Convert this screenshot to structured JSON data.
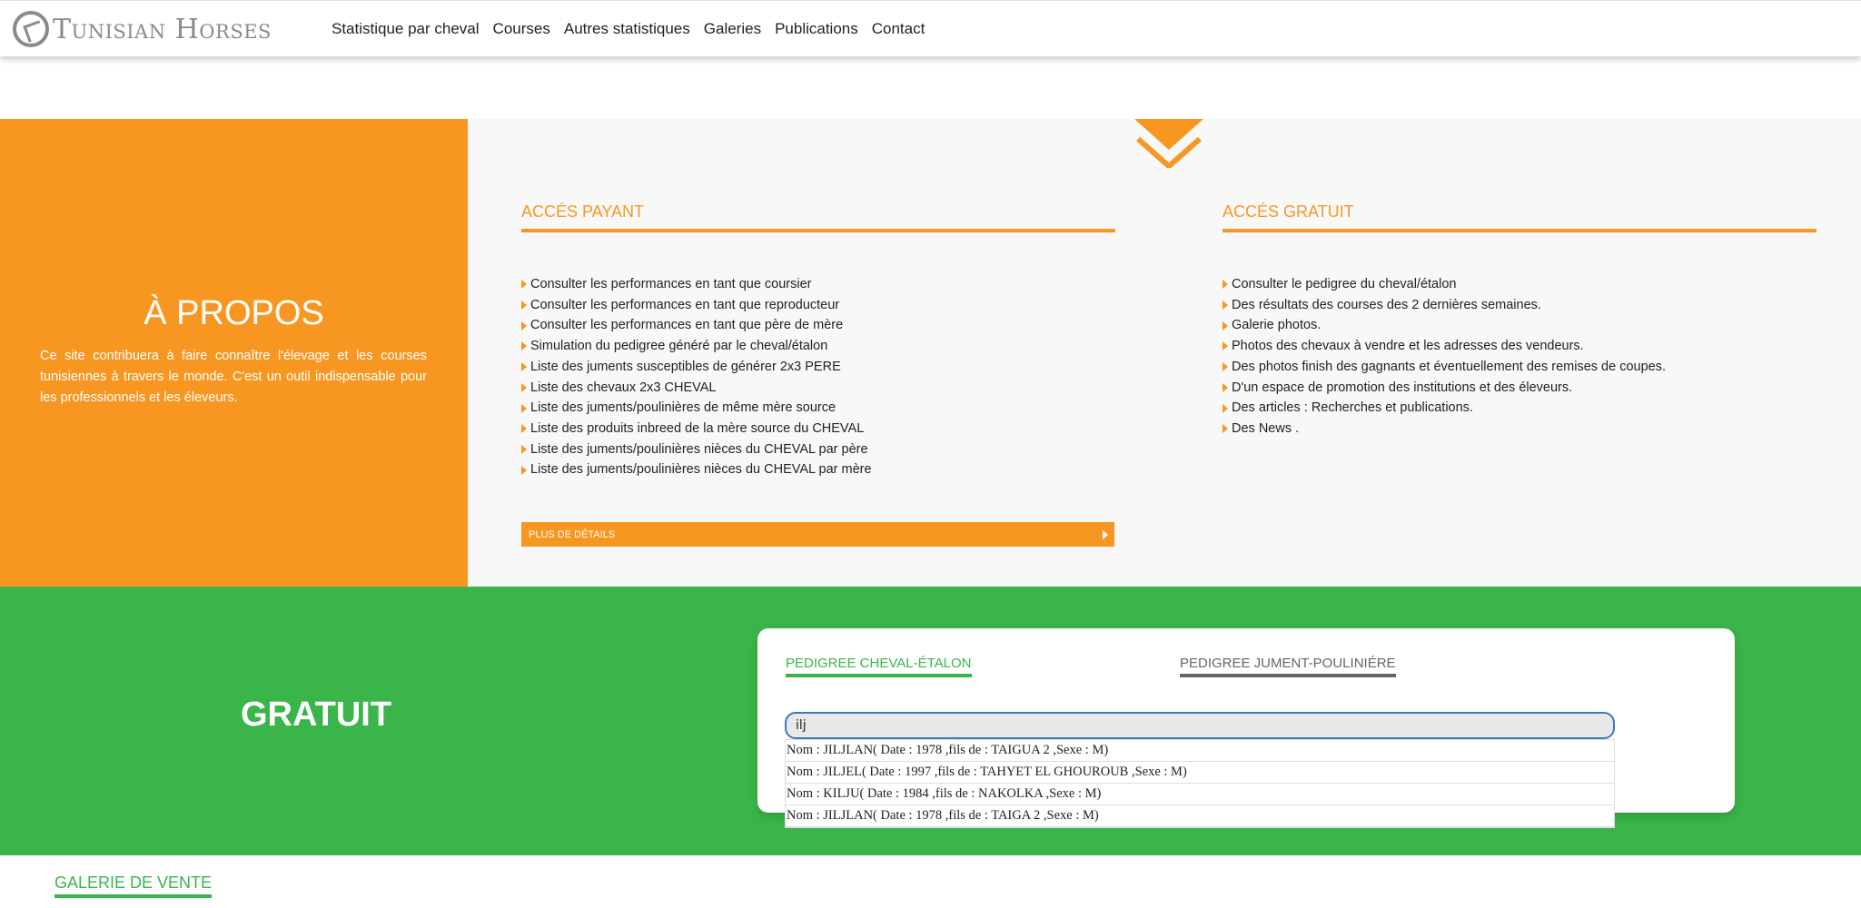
{
  "header": {
    "logo_text": "Tunisian Horses",
    "nav": [
      "Statistique par cheval",
      "Courses",
      "Autres statistiques",
      "Galeries",
      "Publications",
      "Contact"
    ]
  },
  "about": {
    "title": "À PROPOS",
    "description": "Ce site contribuera à faire connaître l'élevage et les courses tunisiennes à travers le monde. C'est un outil indispensable pour les professionnels et les éleveurs."
  },
  "paid": {
    "title": "ACCÉS PAYANT",
    "items": [
      "Consulter les performances en tant que coursier",
      "Consulter les performances en tant que reproducteur",
      "Consulter les performances en tant que père de mère",
      "Simulation du pedigree généré par le cheval/étalon",
      "Liste des juments susceptibles de générer 2x3 PERE",
      "Liste des chevaux 2x3 CHEVAL",
      "Liste des juments/poulinières de même mère source",
      "Liste des produits inbreed de la mère source du CHEVAL",
      "Liste des juments/poulinières nièces du CHEVAL par père",
      "Liste des juments/poulinières nièces du CHEVAL par mère"
    ],
    "button": "PLUS DE DÉTAILS"
  },
  "free": {
    "title": "ACCÉS GRATUIT",
    "items": [
      "Consulter le pedigree du cheval/étalon",
      "Des résultats des courses des 2 dernières semaines.",
      "Galerie photos.",
      "Photos des chevaux à vendre et les adresses des vendeurs.",
      "Des photos finish des gagnants et éventuellement des remises de coupes.",
      "D'un espace de promotion des institutions et des éleveurs.",
      "Des articles : Recherches et publications.",
      "Des News ."
    ]
  },
  "gratuit": {
    "title": "GRATUIT",
    "tab_active": "PEDIGREE CHEVAL-ÉTALON",
    "tab_other": "PEDIGREE JUMENT-POULINIÉRE",
    "search_value": "ilj",
    "suggestions": [
      "Nom : JILJLAN( Date : 1978 ,fils de : TAIGUA 2 ,Sexe : M)",
      "Nom : JILJEL( Date : 1997 ,fils de : TAHYET EL GHOUROUB ,Sexe : M)",
      "Nom : KILJU( Date : 1984 ,fils de : NAKOLKA ,Sexe : M)",
      "Nom : JILJLAN( Date : 1978 ,fils de : TAIGA 2 ,Sexe : M)"
    ]
  },
  "gallery": {
    "title": "GALERIE DE VENTE"
  },
  "colors": {
    "orange": "#f79722",
    "green": "#3ab54a",
    "light_bg": "#f8f8f8"
  },
  "icons": [
    "logo-icon",
    "chevron-down-icon",
    "bullet-arrow-icon",
    "arrow-right-icon"
  ]
}
